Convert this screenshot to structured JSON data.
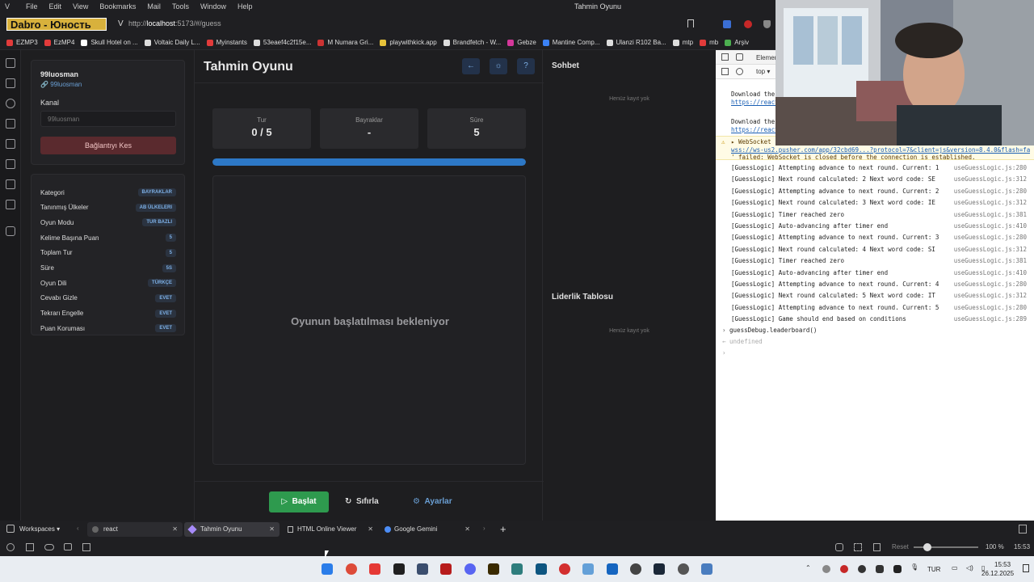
{
  "menubar": {
    "items": [
      "File",
      "Edit",
      "View",
      "Bookmarks",
      "Mail",
      "Tools",
      "Window",
      "Help"
    ],
    "window_title": "Tahmin Oyunu"
  },
  "browser": {
    "brand_overlay": "Dabro - Юность",
    "url_prefix": "http://",
    "url_host": "localhost",
    "url_rest": ":5173/#/guess"
  },
  "bookmarks": [
    {
      "label": "EZMP3",
      "color": "#e23b3b"
    },
    {
      "label": "EzMP4",
      "color": "#e23b3b"
    },
    {
      "label": "Skull Hotel on ...",
      "color": "#ffffff"
    },
    {
      "label": "Voltaic Daily L...",
      "color": "#dddddd"
    },
    {
      "label": "Myinstants",
      "color": "#e23b3b"
    },
    {
      "label": "53eaef4c2f15e...",
      "color": "#dddddd"
    },
    {
      "label": "M Numara Gri...",
      "color": "#cc3333"
    },
    {
      "label": "playwithkick.app",
      "color": "#e6c23a"
    },
    {
      "label": "Brandfetch - W...",
      "color": "#dddddd"
    },
    {
      "label": "Gebze",
      "color": "#d4379a"
    },
    {
      "label": "Mantine Comp...",
      "color": "#3b82f6"
    },
    {
      "label": "Ulanzi R102 Ba...",
      "color": "#dddddd"
    },
    {
      "label": "mtp",
      "color": "#dddddd"
    },
    {
      "label": "mb",
      "color": "#e23b3b"
    },
    {
      "label": "Arşiv",
      "color": "#4caf50"
    }
  ],
  "user": {
    "name": "99luosman",
    "link": "99luosman",
    "channel_label": "Kanal",
    "channel_placeholder": "99luosman",
    "disconnect_label": "Bağlantıyı Kes"
  },
  "settings": [
    {
      "label": "Kategori",
      "value": "BAYRAKLAR"
    },
    {
      "label": "Tanınmış Ülkeler",
      "value": "AB ÜLKELERI"
    },
    {
      "label": "Oyun Modu",
      "value": "TUR BAZLI"
    },
    {
      "label": "Kelime Başına Puan",
      "value": "5"
    },
    {
      "label": "Toplam Tur",
      "value": "5"
    },
    {
      "label": "Süre",
      "value": "5S"
    },
    {
      "label": "Oyun Dili",
      "value": "TÜRKÇE"
    },
    {
      "label": "Cevabı Gizle",
      "value": "EVET"
    },
    {
      "label": "Tekrarı Engelle",
      "value": "EVET"
    },
    {
      "label": "Puan Koruması",
      "value": "EVET"
    }
  ],
  "game": {
    "title": "Tahmin Oyunu",
    "stats": [
      {
        "label": "Tur",
        "value": "0 / 5"
      },
      {
        "label": "Bayraklar",
        "value": "-"
      },
      {
        "label": "Süre",
        "value": "5"
      }
    ],
    "progress": 1.0,
    "waiting_text": "Oyunun başlatılması bekleniyor",
    "start_label": "Başlat",
    "reset_label": "Sıfırla",
    "settings_label": "Ayarlar"
  },
  "chat": {
    "title": "Sohbet",
    "empty": "Henüz kayıt yok",
    "leaderboard_title": "Liderlik Tablosu",
    "leaderboard_empty": "Henüz kayıt yok"
  },
  "devtools": {
    "tab": "Elemer",
    "context": "top",
    "download1": "Download the",
    "download1_link": "https://react",
    "download2": "Download the",
    "download2_link": "https://react",
    "warn_title": "▸ WebSocket",
    "warn_url": "wss://ws-us2.pusher.com/app/32cbd69...?protocol=7&client=js&version=8.4.0&flash=fa...",
    "warn_detail": "' failed: WebSocket is closed before the connection is established.",
    "logs": [
      {
        "msg": "[GuessLogic] Attempting advance to next round. Current: 1",
        "src": "useGuessLogic.js:280"
      },
      {
        "msg": "[GuessLogic] Next round calculated: 2 Next word code: SE",
        "src": "useGuessLogic.js:312"
      },
      {
        "msg": "[GuessLogic] Attempting advance to next round. Current: 2",
        "src": "useGuessLogic.js:280"
      },
      {
        "msg": "[GuessLogic] Next round calculated: 3 Next word code: IE",
        "src": "useGuessLogic.js:312"
      },
      {
        "msg": "[GuessLogic] Timer reached zero",
        "src": "useGuessLogic.js:381"
      },
      {
        "msg": "[GuessLogic] Auto-advancing after timer end",
        "src": "useGuessLogic.js:410"
      },
      {
        "msg": "[GuessLogic] Attempting advance to next round. Current: 3",
        "src": "useGuessLogic.js:280"
      },
      {
        "msg": "[GuessLogic] Next round calculated: 4 Next word code: SI",
        "src": "useGuessLogic.js:312"
      },
      {
        "msg": "[GuessLogic] Timer reached zero",
        "src": "useGuessLogic.js:381"
      },
      {
        "msg": "[GuessLogic] Auto-advancing after timer end",
        "src": "useGuessLogic.js:410"
      },
      {
        "msg": "[GuessLogic] Attempting advance to next round. Current: 4",
        "src": "useGuessLogic.js:280"
      },
      {
        "msg": "[GuessLogic] Next round calculated: 5 Next word code: IT",
        "src": "useGuessLogic.js:312"
      },
      {
        "msg": "[GuessLogic] Attempting advance to next round. Current: 5",
        "src": "useGuessLogic.js:280"
      },
      {
        "msg": "[GuessLogic] Game should end based on conditions",
        "src": "useGuessLogic.js:289"
      }
    ],
    "command": "guessDebug.leaderboard()",
    "result": "undefined"
  },
  "tabs": {
    "workspaces": "Workspaces",
    "items": [
      "react",
      "Tahmin Oyunu",
      "HTML Online Viewer",
      "Google Gemini"
    ]
  },
  "status": {
    "reset": "Reset",
    "zoom": "100 %",
    "time": "15:53"
  },
  "taskbar": {
    "lang": "TUR",
    "clock_time": "15:53",
    "clock_date": "26.12.2025"
  }
}
